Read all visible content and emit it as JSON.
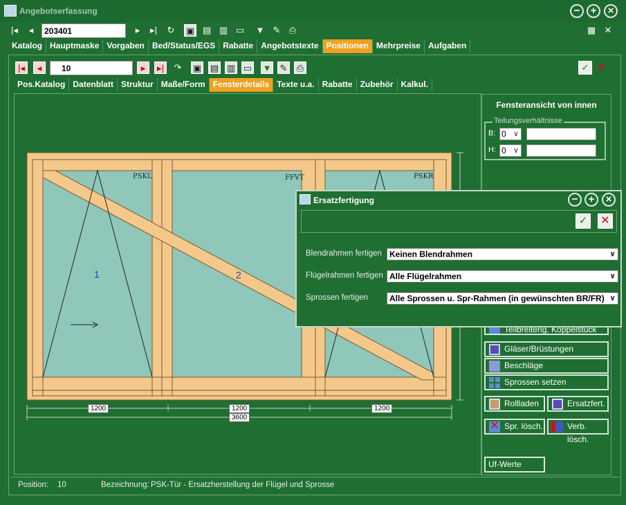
{
  "window": {
    "title": "Angebotserfassung"
  },
  "toolbar1": {
    "record": "203401"
  },
  "main_tabs": [
    {
      "label": "Katalog"
    },
    {
      "label": "Hauptmaske"
    },
    {
      "label": "Vorgaben"
    },
    {
      "label": "Bed/Status/EGS"
    },
    {
      "label": "Rabatte"
    },
    {
      "label": "Angebotstexte"
    },
    {
      "label": "Positionen"
    },
    {
      "label": "Mehrpreise"
    },
    {
      "label": "Aufgaben"
    }
  ],
  "toolbar2": {
    "position": "10"
  },
  "sub_tabs": [
    {
      "label": "Pos.Katalog"
    },
    {
      "label": "Datenblatt"
    },
    {
      "label": "Struktur"
    },
    {
      "label": "Maße/Form"
    },
    {
      "label": "Fensterdetails"
    },
    {
      "label": "Texte u.a."
    },
    {
      "label": "Rabatte"
    },
    {
      "label": "Zubehör"
    },
    {
      "label": "Kalkul."
    }
  ],
  "right_panel": {
    "title": "Fensteransicht von innen",
    "legend": "Teilungsverhältnisse",
    "b_label": "B:",
    "b_value": "0",
    "h_label": "H:",
    "h_value": "0",
    "partial_btn": "Teilbreiteng. Koppelstück",
    "buttons": {
      "glaeser": "Gläser/Brüstungen",
      "beschlaege": "Beschläge",
      "sprossen": "Sprossen setzen",
      "rollladen": "Rollladen",
      "ersatzfert": "Ersatzfert.",
      "spr_loesch": "Spr. lösch.",
      "verb_loesch": "Verb. lösch.",
      "uf_werte": "Uf-Werte"
    }
  },
  "drawing": {
    "sash_labels": [
      "PSKL",
      "FFVT",
      "PSKR"
    ],
    "sash_numbers": [
      "1",
      "2"
    ],
    "dims": {
      "left": "1200",
      "mid": "1200",
      "right": "1200",
      "total": "3600"
    }
  },
  "dialog": {
    "title": "Ersatzfertigung",
    "rows": [
      {
        "label": "Blendrahmen fertigen",
        "value": "Keinen Blendrahmen"
      },
      {
        "label": "Flügelrahmen fertigen",
        "value": "Alle Flügelrahmen"
      },
      {
        "label": "Sprossen fertigen",
        "value": "Alle Sprossen u. Spr-Rahmen (in gewünschten BR/FR)"
      }
    ]
  },
  "status": {
    "pos_label": "Position:",
    "pos_value": "10",
    "bez_label": "Bezeichnung:",
    "bez_value": "PSK-Tür - Ersatzherstellung der Flügel und Sprosse"
  },
  "colors": {
    "background": "#1f6e32",
    "active_tab": "#f0a020",
    "frame": "#f4c88a",
    "glass": "#8fc7bb"
  }
}
